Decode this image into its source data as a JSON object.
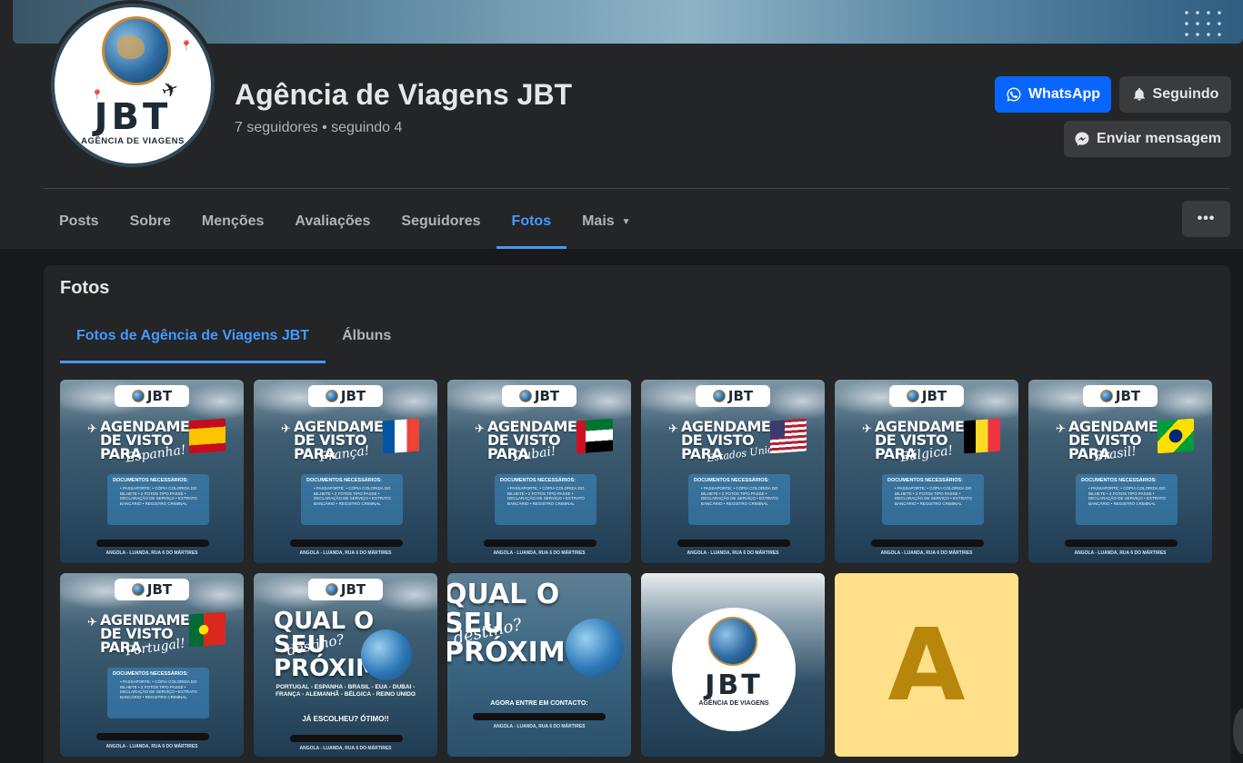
{
  "page": {
    "title": "Agência de Viagens JBT",
    "stats": "7 seguidores • seguindo 4",
    "avatar": {
      "brand": "JBT",
      "subtitle": "AGÊNCIA DE VIAGENS"
    }
  },
  "actions": {
    "whatsapp": "WhatsApp",
    "following": "Seguindo",
    "message": "Enviar mensagem",
    "more": "•••"
  },
  "tabs": [
    {
      "label": "Posts"
    },
    {
      "label": "Sobre"
    },
    {
      "label": "Menções"
    },
    {
      "label": "Avaliações"
    },
    {
      "label": "Seguidores"
    },
    {
      "label": "Fotos"
    },
    {
      "label": "Mais"
    }
  ],
  "photos": {
    "title": "Fotos",
    "subtabs": [
      {
        "label": "Fotos de Agência de Viagens JBT"
      },
      {
        "label": "Álbuns"
      }
    ],
    "visa_heading": "AGENDAMENTO DE VISTO PARA",
    "docs_heading": "DOCUMENTOS NECESSÁRIOS:",
    "docs_list": "• PASSAPORTE; • CÓPIA COLORIDA DO BILHETE • 2 FOTOS TIPO PASSE • DECLARAÇÃO DE SERVIÇO • EXTRATO BANCÁRIO • REGISTRO CRIMINAL",
    "address": "ANGOLA - LUANDA, RUA 6 DO MÁRTIRES",
    "logo_text": "JBT",
    "destinations": [
      {
        "country": "Espanha!"
      },
      {
        "country": "França!"
      },
      {
        "country": "Dubai!"
      },
      {
        "country": "Estados Unidos!"
      },
      {
        "country": "Bélgica!"
      },
      {
        "country": "Brasil!"
      },
      {
        "country": "Portugal!"
      }
    ],
    "promo": {
      "heading": "QUAL O SEU PRÓXIMO",
      "script": "destino?",
      "countries": "PORTUGAL - ESPANHA - BRASIL - EUA - DUBAI - FRANÇA - ALEMANHÃ - BÉLGICA - REINO UNIDO",
      "ready": "JÁ ESCOLHEU? ÓTIMO!!",
      "contact": "AGORA ENTRE EM CONTACTO:"
    },
    "brand_tile": {
      "brand": "JBT",
      "subtitle": "AGÊNCIA DE VIAGENS"
    },
    "letter_tile": "A"
  },
  "colors": {
    "accent": "#4599ff",
    "primary_button": "#0866ff",
    "surface": "#242526",
    "background": "#18191a"
  }
}
